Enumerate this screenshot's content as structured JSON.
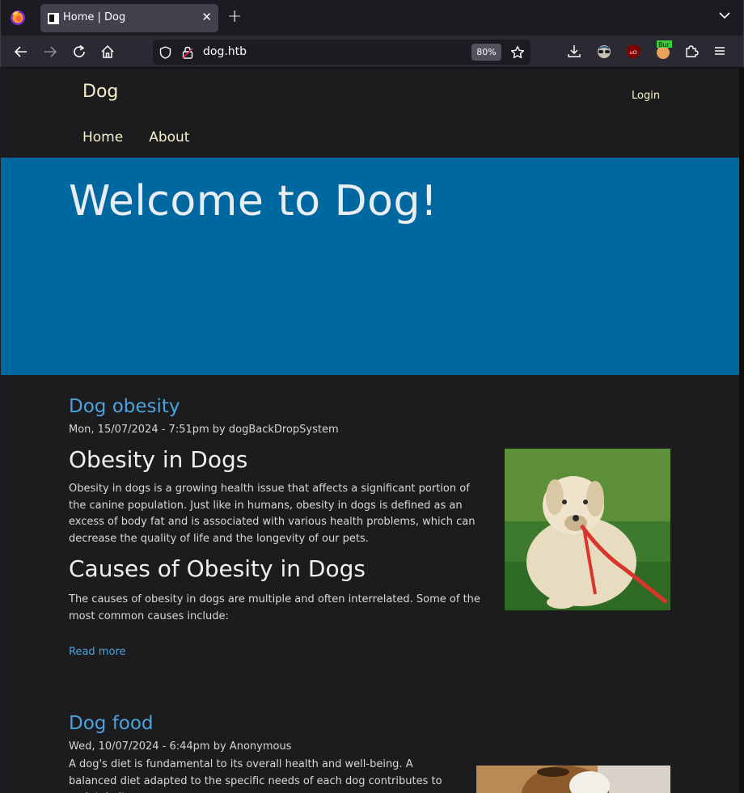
{
  "browser": {
    "tab_title": "Home | Dog",
    "url": "dog.htb",
    "zoom": "80%"
  },
  "site": {
    "name": "Dog",
    "login": "Login",
    "nav": [
      "Home",
      "About"
    ],
    "hero_title": "Welcome to Dog!"
  },
  "articles": [
    {
      "title": "Dog obesity",
      "meta": "Mon, 15/07/2024 - 7:51pm by dogBackDropSystem",
      "h2_1": "Obesity in Dogs",
      "p1": "Obesity in dogs is a growing health issue that affects a significant portion of the canine population. Just like in humans, obesity in dogs is defined as an excess of body fat and is associated with various health problems, which can decrease the quality of life and the longevity of our pets.",
      "h2_2": "Causes of Obesity in Dogs",
      "p2": "The causes of obesity in dogs are multiple and often interrelated. Some of the most common causes include:",
      "read_more": "Read more"
    },
    {
      "title": "Dog food",
      "meta": "Wed, 10/07/2024 - 6:44pm by Anonymous",
      "p1": "A dog's diet is fundamental to its overall health and well-being. A balanced diet adapted to the specific needs of each dog contributes to maintain its energy"
    }
  ],
  "icons": {
    "back": "back-arrow-icon",
    "forward": "forward-arrow-icon",
    "reload": "reload-icon",
    "home": "home-icon",
    "bookmark": "star-icon",
    "downloads": "download-icon"
  },
  "colors": {
    "hero_bg": "#0068a0",
    "link": "#4aa3df",
    "header_text": "#f5f0c9"
  }
}
